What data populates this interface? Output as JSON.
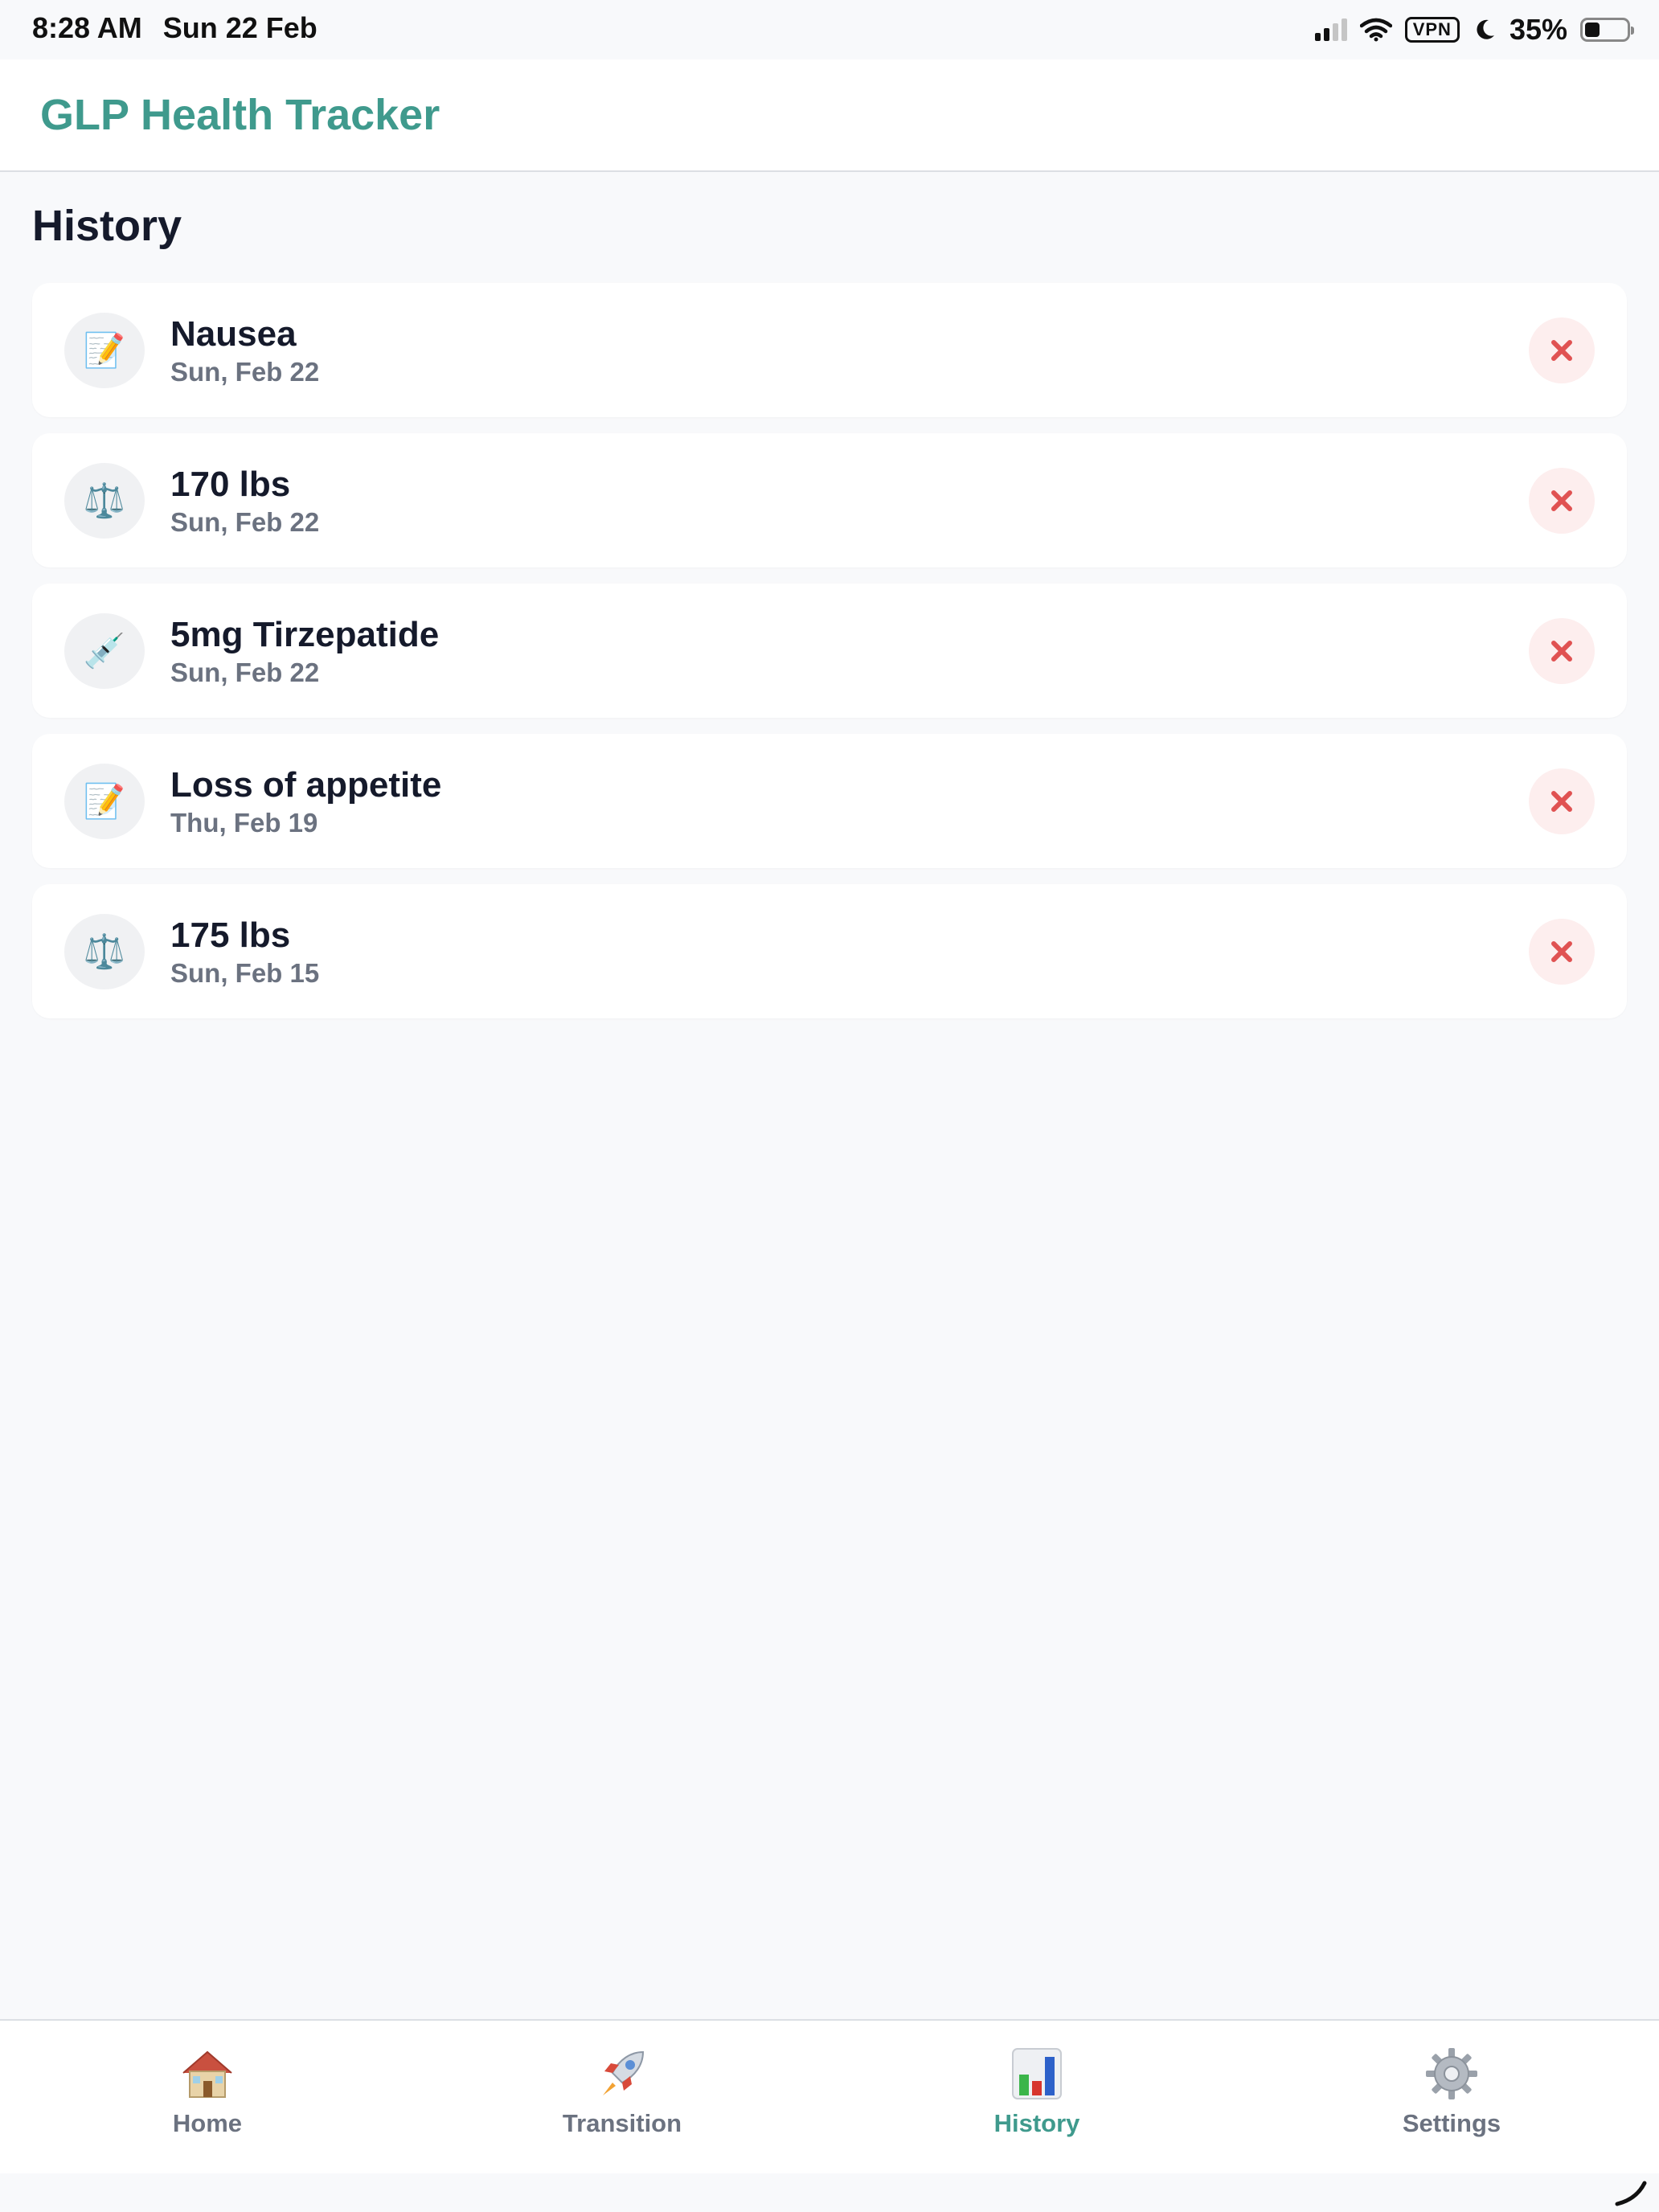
{
  "status_bar": {
    "time": "8:28 AM",
    "date": "Sun 22 Feb",
    "vpn": "VPN",
    "battery": "35%",
    "battery_level": 0.35
  },
  "header": {
    "title": "GLP Health Tracker"
  },
  "page": {
    "title": "History"
  },
  "entries": [
    {
      "icon": "memo-icon",
      "title": "Nausea",
      "date": "Sun, Feb 22"
    },
    {
      "icon": "scale-icon",
      "title": "170 lbs",
      "date": "Sun, Feb 22"
    },
    {
      "icon": "syringe-icon",
      "title": "5mg Tirzepatide",
      "date": "Sun, Feb 22"
    },
    {
      "icon": "memo-icon",
      "title": "Loss of appetite",
      "date": "Thu, Feb 19"
    },
    {
      "icon": "scale-icon",
      "title": "175 lbs",
      "date": "Sun, Feb 15"
    }
  ],
  "nav": {
    "items": [
      {
        "label": "Home",
        "icon": "house-icon"
      },
      {
        "label": "Transition",
        "icon": "rocket-icon"
      },
      {
        "label": "History",
        "icon": "bar-chart-icon",
        "active": true
      },
      {
        "label": "Settings",
        "icon": "gear-icon"
      }
    ]
  },
  "colors": {
    "accent": "#3f9a8d",
    "delete": "#e05252",
    "delete_bg": "#fdeeee",
    "text_primary": "#151a2b",
    "text_secondary": "#6b7280"
  }
}
